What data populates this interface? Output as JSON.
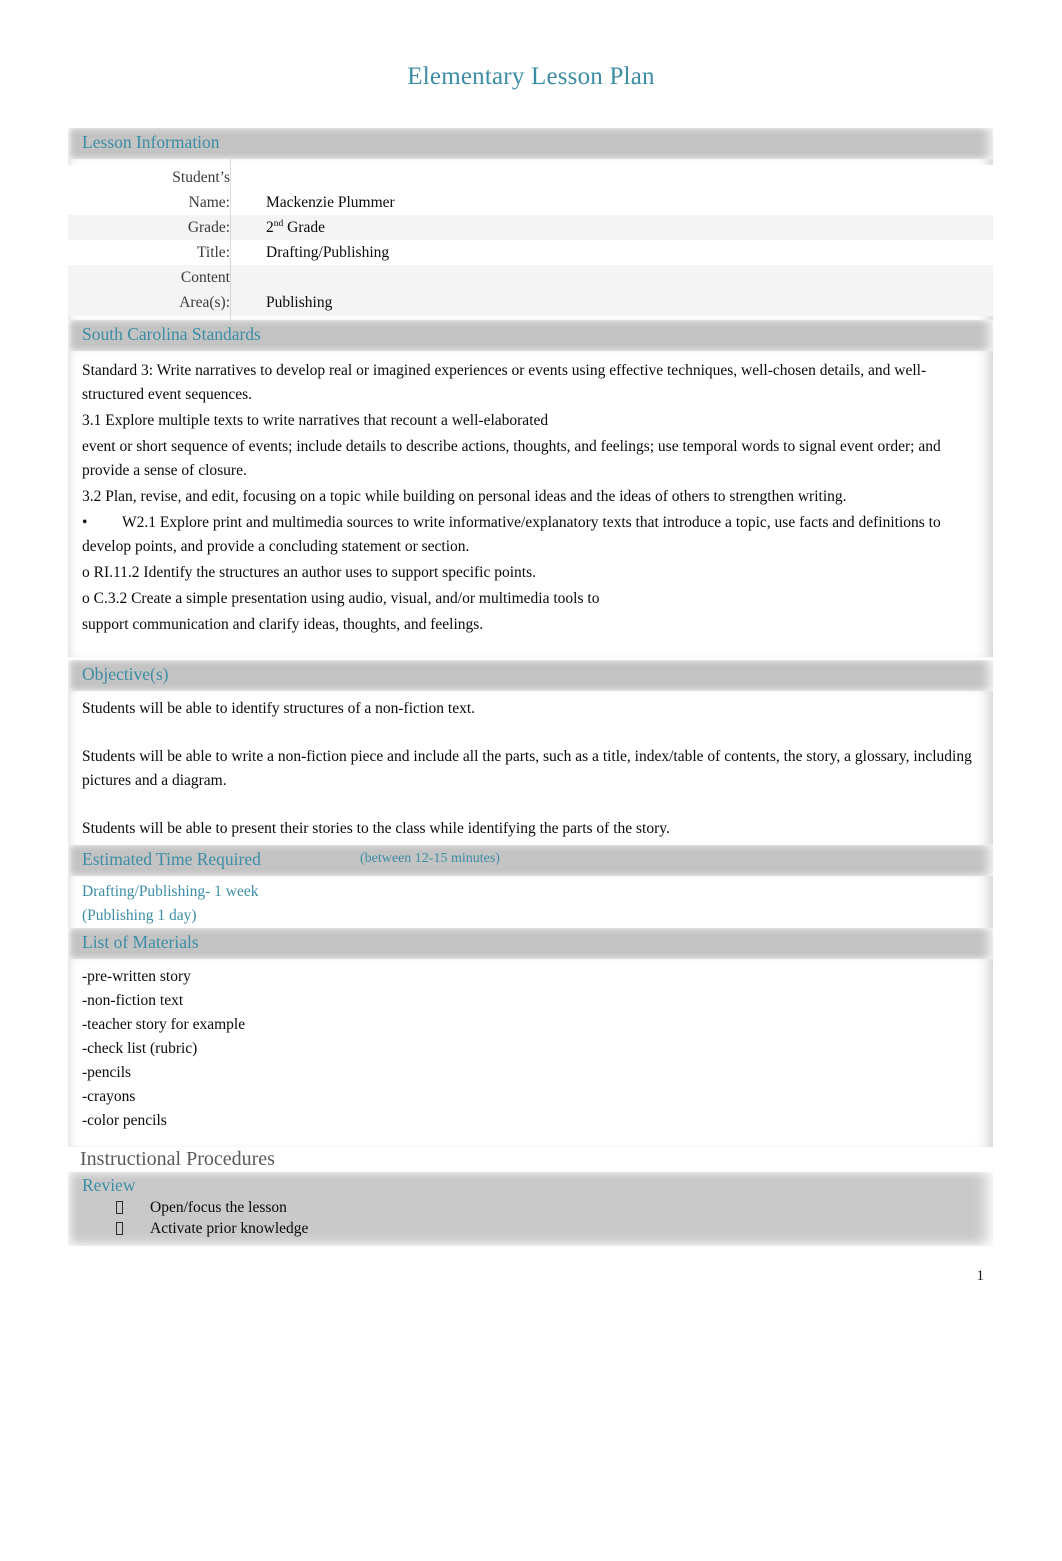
{
  "document": {
    "title": "Elementary Lesson Plan",
    "page_number": "1",
    "accent_color": "#3c8da5",
    "band_color": "#c3c3c3"
  },
  "lesson_information": {
    "heading": "Lesson Information",
    "rows": [
      {
        "label": "Student’s Name:",
        "label_line1": "Student’s",
        "label_line2": "Name:",
        "value": "Mackenzie Plummer"
      },
      {
        "label": "Grade:",
        "value_prefix": "2",
        "value_sup": "nd",
        "value_suffix": "Grade"
      },
      {
        "label": "Title:",
        "value": "Drafting/Publishing"
      },
      {
        "label": "Content Area(s):",
        "label_line1": "Content",
        "label_line2": "Area(s):",
        "value": "Publishing"
      }
    ]
  },
  "south_carolina_standards": {
    "heading": "South Carolina Standards",
    "paragraphs": [
      "Standard 3: Write narratives to develop real or imagined experiences or events using effective techniques, well-chosen details, and well- structured event sequences.",
      "3.1 Explore multiple texts to write narratives that recount a well-elaborated",
      "event or short sequence of events; include details to describe actions, thoughts, and feelings; use temporal words to signal event order; and provide a sense of closure.",
      "3.2 Plan, revise, and edit, focusing on a topic while building on personal ideas and the ideas of others to strengthen writing.",
      "•   W2.1 Explore print and multimedia sources to write informative/explanatory texts that introduce a topic, use facts and definitions to develop points, and provide a concluding statement or section.",
      "o RI.11.2 Identify the structures an author uses to support specific points.",
      "o C.3.2 Create a simple presentation using audio, visual, and/or multimedia tools to",
      "support communication and clarify ideas, thoughts, and feelings."
    ]
  },
  "objectives": {
    "heading": "Objective(s)",
    "items": [
      "Students will be able to identify structures of a non-fiction text.",
      "Students will be able to write a non-fiction piece and include all the parts, such as a title, index/table of contents, the story, a glossary, including pictures and a diagram.",
      "Students will be able to present their stories to the class while identifying the parts of the story."
    ]
  },
  "estimated_time": {
    "heading": "Estimated Time Required",
    "note": "(between 12-15 minutes)",
    "lines": [
      "Drafting/Publishing- 1 week",
      "(Publishing 1 day)"
    ]
  },
  "materials": {
    "heading": "List of Materials",
    "items": [
      "-pre-written story",
      "-non-fiction text",
      "-teacher story for example",
      "-check list (rubric)",
      "-pencils",
      "-crayons",
      "-color pencils"
    ]
  },
  "instructional_procedures": {
    "heading": "Instructional Procedures",
    "review": {
      "heading": "Review",
      "items": [
        "Open/focus the lesson",
        "Activate prior knowledge"
      ]
    }
  }
}
